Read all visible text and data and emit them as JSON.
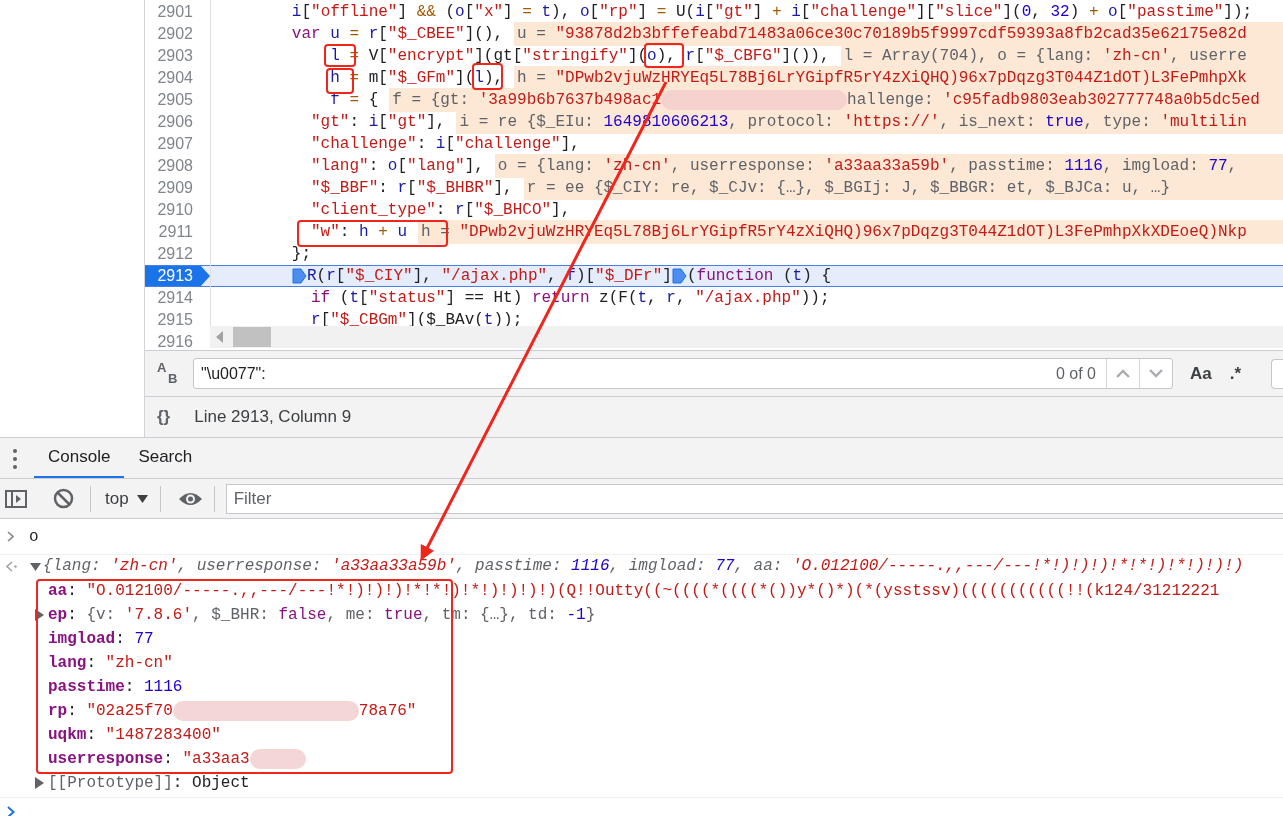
{
  "code_lines": [
    {
      "number": "2901",
      "paused": false,
      "tokens": [
        {
          "kind": "ident",
          "text": "        i"
        },
        {
          "kind": "plain",
          "text": "["
        },
        {
          "kind": "str",
          "text": "\"offline\""
        },
        {
          "kind": "plain",
          "text": "] "
        },
        {
          "kind": "op",
          "text": "&&"
        },
        {
          "kind": "plain",
          "text": " ("
        },
        {
          "kind": "ident",
          "text": "o"
        },
        {
          "kind": "plain",
          "text": "["
        },
        {
          "kind": "str",
          "text": "\"x\""
        },
        {
          "kind": "plain",
          "text": "] "
        },
        {
          "kind": "op",
          "text": "="
        },
        {
          "kind": "ident",
          "text": " t"
        },
        {
          "kind": "plain",
          "text": "), "
        },
        {
          "kind": "ident",
          "text": "o"
        },
        {
          "kind": "plain",
          "text": "["
        },
        {
          "kind": "str",
          "text": "\"rp\""
        },
        {
          "kind": "plain",
          "text": "] "
        },
        {
          "kind": "op",
          "text": "="
        },
        {
          "kind": "plain",
          "text": " U("
        },
        {
          "kind": "ident",
          "text": "i"
        },
        {
          "kind": "plain",
          "text": "["
        },
        {
          "kind": "str",
          "text": "\"gt\""
        },
        {
          "kind": "plain",
          "text": "] "
        },
        {
          "kind": "op",
          "text": "+"
        },
        {
          "kind": "ident",
          "text": " i"
        },
        {
          "kind": "plain",
          "text": "["
        },
        {
          "kind": "str",
          "text": "\"challenge\""
        },
        {
          "kind": "plain",
          "text": "]["
        },
        {
          "kind": "str",
          "text": "\"slice\""
        },
        {
          "kind": "plain",
          "text": "]("
        },
        {
          "kind": "num",
          "text": "0"
        },
        {
          "kind": "plain",
          "text": ", "
        },
        {
          "kind": "num",
          "text": "32"
        },
        {
          "kind": "plain",
          "text": ") "
        },
        {
          "kind": "op",
          "text": "+"
        },
        {
          "kind": "ident",
          "text": " o"
        },
        {
          "kind": "plain",
          "text": "["
        },
        {
          "kind": "str",
          "text": "\"passtime\""
        },
        {
          "kind": "plain",
          "text": "]);"
        }
      ]
    },
    {
      "number": "2902",
      "paused": false,
      "tokens": [
        {
          "kind": "kw",
          "text": "        var"
        },
        {
          "kind": "ident",
          "text": " u"
        },
        {
          "kind": "op",
          "text": " ="
        },
        {
          "kind": "ident",
          "text": " r"
        },
        {
          "kind": "plain",
          "text": "["
        },
        {
          "kind": "str",
          "text": "\"$_CBEE\""
        },
        {
          "kind": "plain",
          "text": "](),"
        }
      ],
      "inline": [
        {
          "kind": "gray",
          "text": "u = "
        },
        {
          "kind": "str",
          "text": "\"93878d2b3bffefeabd71483a06ce30c70189b5f9997cdf59393a8fb2cad35e62175e82d"
        }
      ]
    },
    {
      "number": "2903",
      "paused": false,
      "tokens": [
        {
          "kind": "ident",
          "text": "            l"
        },
        {
          "kind": "op",
          "text": " ="
        },
        {
          "kind": "plain",
          "text": " V["
        },
        {
          "kind": "str",
          "text": "\"encrypt\""
        },
        {
          "kind": "plain",
          "text": "](gt["
        },
        {
          "kind": "str",
          "text": "\"stringify\""
        },
        {
          "kind": "plain",
          "text": "]("
        },
        {
          "kind": "ident",
          "text": "o"
        },
        {
          "kind": "plain",
          "text": "), "
        },
        {
          "kind": "ident",
          "text": "r"
        },
        {
          "kind": "plain",
          "text": "["
        },
        {
          "kind": "str",
          "text": "\"$_CBFG\""
        },
        {
          "kind": "plain",
          "text": "]()),"
        }
      ],
      "inline": [
        {
          "kind": "gray",
          "text": "l = Array(704), o = {lang: "
        },
        {
          "kind": "str",
          "text": "'zh-cn'"
        },
        {
          "kind": "gray",
          "text": ", userre"
        }
      ]
    },
    {
      "number": "2904",
      "paused": false,
      "tokens": [
        {
          "kind": "ident",
          "text": "            h"
        },
        {
          "kind": "op",
          "text": " ="
        },
        {
          "kind": "plain",
          "text": " m["
        },
        {
          "kind": "str",
          "text": "\"$_GFm\""
        },
        {
          "kind": "plain",
          "text": "]("
        },
        {
          "kind": "ident",
          "text": "l"
        },
        {
          "kind": "plain",
          "text": "),"
        }
      ],
      "inline": [
        {
          "kind": "gray",
          "text": "h = "
        },
        {
          "kind": "str",
          "text": "\"DPwb2vjuWzHRYEq5L78Bj6LrYGipfR5rY4zXiQHQ)96x7pDqzg3T044Z1dOT)L3FePmhpXk"
        }
      ]
    },
    {
      "number": "2905",
      "paused": false,
      "tokens": [
        {
          "kind": "ident",
          "text": "            f"
        },
        {
          "kind": "op",
          "text": " ="
        },
        {
          "kind": "plain",
          "text": " {"
        }
      ],
      "inline": [
        {
          "kind": "gray",
          "text": "f = {gt: "
        },
        {
          "kind": "str",
          "text": "'3a99b6b7637b498ac1"
        },
        {
          "kind": "blur_long"
        },
        {
          "kind": "gray",
          "text": "hallenge: "
        },
        {
          "kind": "str",
          "text": "'c95fadb9803eab302777748a0b5dc5ed"
        }
      ]
    },
    {
      "number": "2906",
      "paused": false,
      "tokens": [
        {
          "kind": "str",
          "text": "          \"gt\""
        },
        {
          "kind": "plain",
          "text": ": "
        },
        {
          "kind": "ident",
          "text": "i"
        },
        {
          "kind": "plain",
          "text": "["
        },
        {
          "kind": "str",
          "text": "\"gt\""
        },
        {
          "kind": "plain",
          "text": "],"
        }
      ],
      "inline": [
        {
          "kind": "gray",
          "text": "i = re {$_EIu: "
        },
        {
          "kind": "num",
          "text": "1649810606213"
        },
        {
          "kind": "gray",
          "text": ", protocol: "
        },
        {
          "kind": "str",
          "text": "'https://'"
        },
        {
          "kind": "gray",
          "text": ", is_next: "
        },
        {
          "kind": "num",
          "text": "true"
        },
        {
          "kind": "gray",
          "text": ", type: "
        },
        {
          "kind": "str",
          "text": "'multilin"
        }
      ]
    },
    {
      "number": "2907",
      "paused": false,
      "tokens": [
        {
          "kind": "str",
          "text": "          \"challenge\""
        },
        {
          "kind": "plain",
          "text": ": "
        },
        {
          "kind": "ident",
          "text": "i"
        },
        {
          "kind": "plain",
          "text": "["
        },
        {
          "kind": "str",
          "text": "\"challenge\""
        },
        {
          "kind": "plain",
          "text": "],"
        }
      ]
    },
    {
      "number": "2908",
      "paused": false,
      "tokens": [
        {
          "kind": "str",
          "text": "          \"lang\""
        },
        {
          "kind": "plain",
          "text": ": "
        },
        {
          "kind": "ident",
          "text": "o"
        },
        {
          "kind": "plain",
          "text": "["
        },
        {
          "kind": "str",
          "text": "\"lang\""
        },
        {
          "kind": "plain",
          "text": "],"
        }
      ],
      "inline": [
        {
          "kind": "gray",
          "text": "o = {lang: "
        },
        {
          "kind": "str",
          "text": "'zh-cn'"
        },
        {
          "kind": "gray",
          "text": ", userresponse: "
        },
        {
          "kind": "str",
          "text": "'a33aa33a59b'"
        },
        {
          "kind": "gray",
          "text": ", passtime: "
        },
        {
          "kind": "num",
          "text": "1116"
        },
        {
          "kind": "gray",
          "text": ", imgload: "
        },
        {
          "kind": "num",
          "text": "77"
        },
        {
          "kind": "gray",
          "text": ","
        }
      ]
    },
    {
      "number": "2909",
      "paused": false,
      "tokens": [
        {
          "kind": "str",
          "text": "          \"$_BBF\""
        },
        {
          "kind": "plain",
          "text": ": "
        },
        {
          "kind": "ident",
          "text": "r"
        },
        {
          "kind": "plain",
          "text": "["
        },
        {
          "kind": "str",
          "text": "\"$_BHBR\""
        },
        {
          "kind": "plain",
          "text": "],"
        }
      ],
      "inline": [
        {
          "kind": "gray",
          "text": "r = ee {$_CIY: re, $_CJv: {…}, $_BGIj: J, $_BBGR: et, $_BJCa: u, …}"
        }
      ]
    },
    {
      "number": "2910",
      "paused": false,
      "tokens": [
        {
          "kind": "str",
          "text": "          \"client_type\""
        },
        {
          "kind": "plain",
          "text": ": "
        },
        {
          "kind": "ident",
          "text": "r"
        },
        {
          "kind": "plain",
          "text": "["
        },
        {
          "kind": "str",
          "text": "\"$_BHCO\""
        },
        {
          "kind": "plain",
          "text": "],"
        }
      ]
    },
    {
      "number": "2911",
      "paused": false,
      "tokens": [
        {
          "kind": "str",
          "text": "          \"w\""
        },
        {
          "kind": "plain",
          "text": ": "
        },
        {
          "kind": "ident",
          "text": "h"
        },
        {
          "kind": "op",
          "text": " +"
        },
        {
          "kind": "ident",
          "text": " u"
        }
      ],
      "inline": [
        {
          "kind": "gray",
          "text": "h = "
        },
        {
          "kind": "str",
          "text": "\"DPwb2vjuWzHRYEq5L78Bj6LrYGipfR5rY4zXiQHQ)96x7pDqzg3T044Z1dOT)L3FePmhpXkXDEoeQ)Nkp"
        }
      ]
    },
    {
      "number": "2912",
      "paused": false,
      "tokens": [
        {
          "kind": "plain",
          "text": "        };"
        }
      ]
    },
    {
      "number": "2913",
      "paused": true,
      "tokens": [
        {
          "kind": "breakpoint"
        },
        {
          "kind": "ident",
          "text": "R"
        },
        {
          "kind": "plain",
          "text": "("
        },
        {
          "kind": "ident",
          "text": "r"
        },
        {
          "kind": "plain",
          "text": "["
        },
        {
          "kind": "str",
          "text": "\"$_CIY\""
        },
        {
          "kind": "plain",
          "text": "], "
        },
        {
          "kind": "str",
          "text": "\"/ajax.php\""
        },
        {
          "kind": "plain",
          "text": ", "
        },
        {
          "kind": "ident",
          "text": "f"
        },
        {
          "kind": "plain",
          "text": ")["
        },
        {
          "kind": "str",
          "text": "\"$_DFr\""
        },
        {
          "kind": "plain",
          "text": "]"
        },
        {
          "kind": "breakpoint"
        },
        {
          "kind": "plain",
          "text": "("
        },
        {
          "kind": "kw",
          "text": "function"
        },
        {
          "kind": "plain",
          "text": " ("
        },
        {
          "kind": "ident",
          "text": "t"
        },
        {
          "kind": "plain",
          "text": ") {"
        }
      ]
    },
    {
      "number": "2914",
      "paused": false,
      "tokens": [
        {
          "kind": "kw",
          "text": "          if"
        },
        {
          "kind": "plain",
          "text": " ("
        },
        {
          "kind": "ident",
          "text": "t"
        },
        {
          "kind": "plain",
          "text": "["
        },
        {
          "kind": "str",
          "text": "\"status\""
        },
        {
          "kind": "plain",
          "text": "] == Ht) "
        },
        {
          "kind": "kw",
          "text": "return"
        },
        {
          "kind": "plain",
          "text": " z(F("
        },
        {
          "kind": "ident",
          "text": "t"
        },
        {
          "kind": "plain",
          "text": ", "
        },
        {
          "kind": "ident",
          "text": "r"
        },
        {
          "kind": "plain",
          "text": ", "
        },
        {
          "kind": "str",
          "text": "\"/ajax.php\""
        },
        {
          "kind": "plain",
          "text": "));"
        }
      ]
    },
    {
      "number": "2915",
      "paused": false,
      "tokens": [
        {
          "kind": "ident",
          "text": "          r"
        },
        {
          "kind": "plain",
          "text": "["
        },
        {
          "kind": "str",
          "text": "\"$_CBGm\""
        },
        {
          "kind": "plain",
          "text": "]($_BAv("
        },
        {
          "kind": "ident",
          "text": "t"
        },
        {
          "kind": "plain",
          "text": "));"
        }
      ]
    },
    {
      "number": "2916",
      "paused": false
    }
  ],
  "search_bar": {
    "replace_upper": "A",
    "replace_lower": "B",
    "query": "\"\\u0077\":",
    "match_count": "0 of 0",
    "match_case": "Aa",
    "regex": ".*"
  },
  "status_bar": {
    "format_button": "{}",
    "position": "Line 2913, Column 9"
  },
  "drawer_tabs": [
    {
      "label": "Console",
      "selected": true
    },
    {
      "label": "Search",
      "selected": false
    }
  ],
  "console_toolbar": {
    "context": "top",
    "filter_placeholder": "Filter"
  },
  "console": {
    "input": "o",
    "preview": [
      {
        "kind": "gray",
        "text": "{lang: "
      },
      {
        "kind": "str",
        "text": "'zh-cn'"
      },
      {
        "kind": "gray",
        "text": ", userresponse: "
      },
      {
        "kind": "str",
        "text": "'a33aa33a59b'"
      },
      {
        "kind": "gray",
        "text": ", passtime: "
      },
      {
        "kind": "num",
        "text": "1116"
      },
      {
        "kind": "gray",
        "text": ", imgload: "
      },
      {
        "kind": "num",
        "text": "77"
      },
      {
        "kind": "gray",
        "text": ", aa: "
      },
      {
        "kind": "str",
        "text": "'O.012100/-----.,,---/---!*!)!)!)!*!*!)!*!)!)!)"
      }
    ],
    "expanded": true,
    "properties": [
      {
        "key": "aa",
        "kind": "own",
        "expandable": false,
        "value": [
          {
            "kind": "plain",
            "text": ": "
          },
          {
            "kind": "str",
            "text": "\"O.012100/-----.,,---/---!*!)!)!)!*!*!)!*!)!)!)!)(Q!!Outty((~((((*((((*())y*()*)(*(ysstssv)(((((((((((!!(k124/31212221"
          }
        ]
      },
      {
        "key": "ep",
        "kind": "own",
        "expandable": true,
        "value": [
          {
            "kind": "plain",
            "text": ": "
          },
          {
            "kind": "gray",
            "text": "{v: "
          },
          {
            "kind": "str",
            "text": "'7.8.6'"
          },
          {
            "kind": "gray",
            "text": ", $_BHR: "
          },
          {
            "kind": "kw",
            "text": "false"
          },
          {
            "kind": "gray",
            "text": ", me: "
          },
          {
            "kind": "kw",
            "text": "true"
          },
          {
            "kind": "gray",
            "text": ", tm: {…}, td: "
          },
          {
            "kind": "num",
            "text": "-1"
          },
          {
            "kind": "gray",
            "text": "}"
          }
        ]
      },
      {
        "key": "imgload",
        "kind": "own",
        "expandable": false,
        "value": [
          {
            "kind": "plain",
            "text": ": "
          },
          {
            "kind": "num",
            "text": "77"
          }
        ]
      },
      {
        "key": "lang",
        "kind": "own",
        "expandable": false,
        "value": [
          {
            "kind": "plain",
            "text": ": "
          },
          {
            "kind": "str",
            "text": "\"zh-cn\""
          }
        ]
      },
      {
        "key": "passtime",
        "kind": "own",
        "expandable": false,
        "value": [
          {
            "kind": "plain",
            "text": ": "
          },
          {
            "kind": "num",
            "text": "1116"
          }
        ]
      },
      {
        "key": "rp",
        "kind": "own",
        "expandable": false,
        "value": [
          {
            "kind": "plain",
            "text": ": "
          },
          {
            "kind": "str",
            "text": "\"02a25f70"
          },
          {
            "kind": "blur_long"
          },
          {
            "kind": "str",
            "text": "78a76\""
          }
        ]
      },
      {
        "key": "uqkm",
        "kind": "own",
        "expandable": false,
        "value": [
          {
            "kind": "plain",
            "text": ": "
          },
          {
            "kind": "str",
            "text": "\"1487283400\""
          }
        ]
      },
      {
        "key": "userresponse",
        "kind": "own",
        "expandable": false,
        "value": [
          {
            "kind": "plain",
            "text": ": "
          },
          {
            "kind": "str",
            "text": "\"a33aa3"
          },
          {
            "kind": "blur_short"
          }
        ]
      },
      {
        "key": "[[Prototype]]",
        "kind": "internal",
        "expandable": true,
        "value": [
          {
            "kind": "plain",
            "text": ": "
          },
          {
            "kind": "plain",
            "text": "Object"
          }
        ]
      }
    ]
  }
}
